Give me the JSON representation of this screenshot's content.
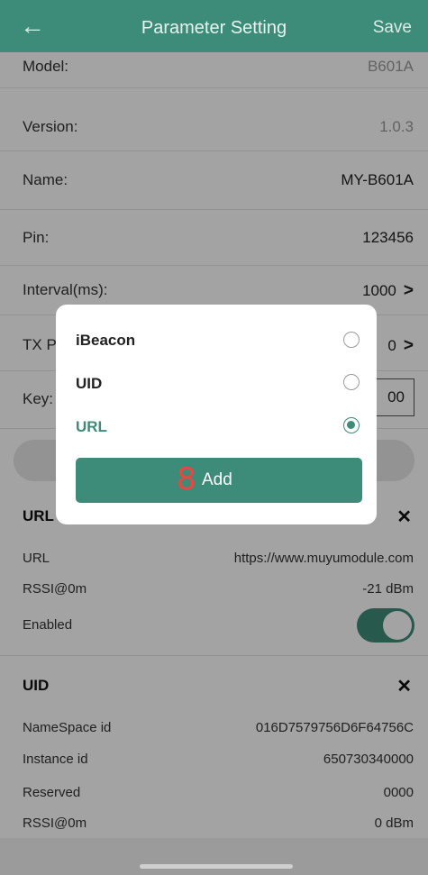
{
  "header": {
    "title": "Parameter Setting",
    "save_label": "Save",
    "back_icon": "arrow-left-icon"
  },
  "fields": {
    "model": {
      "label": "Model:",
      "value": "B601A"
    },
    "version": {
      "label": "Version:",
      "value": "1.0.3"
    },
    "name": {
      "label": "Name:",
      "value": "MY-B601A"
    },
    "pin": {
      "label": "Pin:",
      "value": "123456"
    },
    "interval": {
      "label": "Interval(ms):",
      "value": "1000"
    },
    "tx": {
      "label": "TX P",
      "value": "0"
    },
    "key": {
      "label": "Key:",
      "value": "00"
    }
  },
  "url_section": {
    "title": "URL",
    "rows": [
      {
        "label": "URL",
        "value": "https://www.muyumodule.com"
      },
      {
        "label": "RSSI@0m",
        "value": "-21 dBm"
      },
      {
        "label": "Enabled",
        "value": ""
      }
    ],
    "enabled": true
  },
  "uid_section": {
    "title": "UID",
    "rows": [
      {
        "label": "NameSpace id",
        "value": "016D7579756D6F64756C"
      },
      {
        "label": "Instance id",
        "value": "650730340000"
      },
      {
        "label": "Reserved",
        "value": "0000"
      },
      {
        "label": "RSSI@0m",
        "value": "0 dBm"
      }
    ]
  },
  "dialog": {
    "options": [
      {
        "label": "iBeacon",
        "selected": false
      },
      {
        "label": "UID",
        "selected": false
      },
      {
        "label": "URL",
        "selected": true
      }
    ],
    "badge": "8",
    "add_label": "Add"
  },
  "colors": {
    "accent": "#3d8c79",
    "badge": "#f0443c"
  }
}
